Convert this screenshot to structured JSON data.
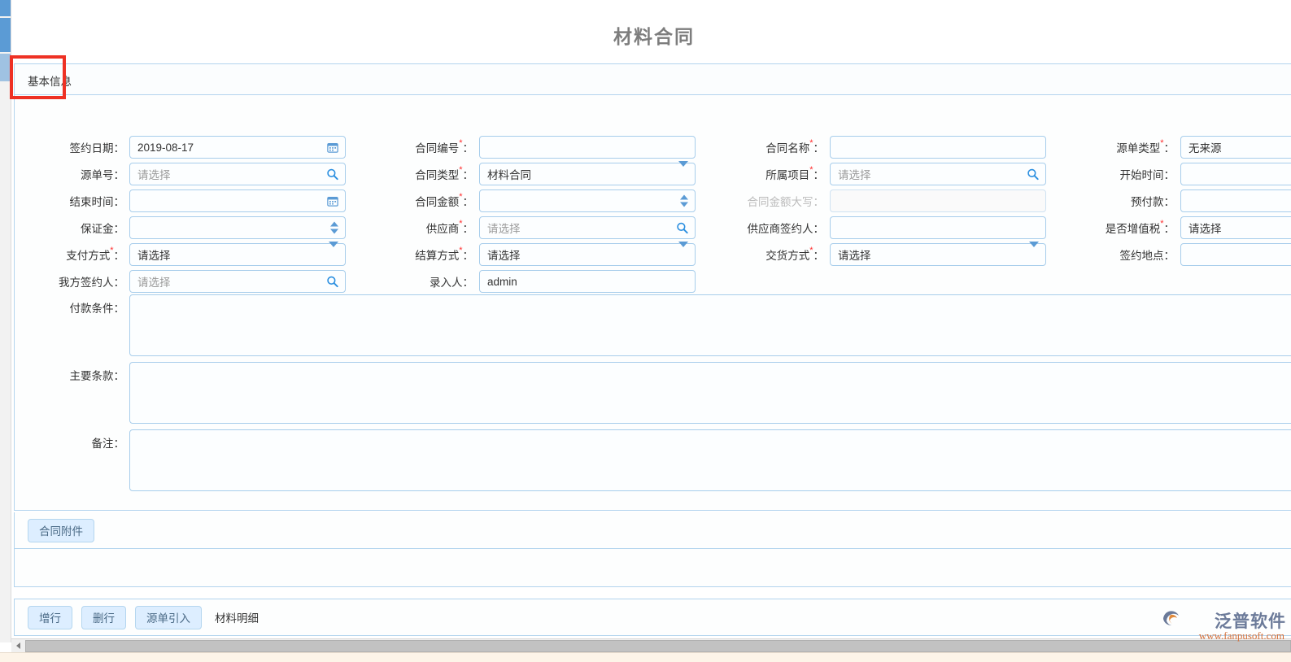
{
  "header": {
    "title": "材料合同"
  },
  "tabs": {
    "basic_info": "基本信息"
  },
  "form": {
    "columns": [
      {
        "fields": [
          {
            "label": "签约日期",
            "required": false,
            "value": "2019-08-17",
            "placeholder": "",
            "icon": "calendar-icon",
            "type": "date"
          },
          {
            "label": "源单号",
            "required": false,
            "value": "",
            "placeholder": "请选择",
            "icon": "search-icon",
            "type": "lookup"
          },
          {
            "label": "结束时间",
            "required": false,
            "value": "",
            "placeholder": "",
            "icon": "calendar-icon",
            "type": "date"
          },
          {
            "label": "保证金",
            "required": false,
            "value": "",
            "placeholder": "",
            "icon": "spinner-icon",
            "type": "number"
          },
          {
            "label": "支付方式",
            "required": true,
            "value": "请选择",
            "placeholder": "请选择",
            "icon": "chevron-down-icon",
            "type": "select"
          },
          {
            "label": "我方签约人",
            "required": false,
            "value": "",
            "placeholder": "请选择",
            "icon": "search-icon",
            "type": "lookup"
          }
        ]
      },
      {
        "fields": [
          {
            "label": "合同编号",
            "required": true,
            "value": "",
            "placeholder": "",
            "icon": "",
            "type": "text"
          },
          {
            "label": "合同类型",
            "required": true,
            "value": "材料合同",
            "placeholder": "",
            "icon": "chevron-down-icon",
            "type": "select"
          },
          {
            "label": "合同金额",
            "required": true,
            "value": "",
            "placeholder": "",
            "icon": "spinner-icon",
            "type": "number"
          },
          {
            "label": "供应商",
            "required": true,
            "value": "",
            "placeholder": "请选择",
            "icon": "search-icon",
            "type": "lookup"
          },
          {
            "label": "结算方式",
            "required": true,
            "value": "请选择",
            "placeholder": "请选择",
            "icon": "chevron-down-icon",
            "type": "select"
          },
          {
            "label": "录入人",
            "required": false,
            "value": "admin",
            "placeholder": "",
            "icon": "",
            "type": "text"
          }
        ]
      },
      {
        "fields": [
          {
            "label": "合同名称",
            "required": true,
            "value": "",
            "placeholder": "",
            "icon": "",
            "type": "text"
          },
          {
            "label": "所属项目",
            "required": true,
            "value": "",
            "placeholder": "请选择",
            "icon": "search-icon",
            "type": "lookup"
          },
          {
            "label": "合同金额大写",
            "required": false,
            "disabled": true,
            "value": "",
            "placeholder": "",
            "icon": "",
            "type": "text"
          },
          {
            "label": "供应商签约人",
            "required": false,
            "value": "",
            "placeholder": "",
            "icon": "",
            "type": "text"
          },
          {
            "label": "交货方式",
            "required": true,
            "value": "请选择",
            "placeholder": "请选择",
            "icon": "chevron-down-icon",
            "type": "select"
          }
        ]
      },
      {
        "fields": [
          {
            "label": "源单类型",
            "required": true,
            "value": "无来源",
            "placeholder": "",
            "icon": "",
            "type": "select"
          },
          {
            "label": "开始时间",
            "required": false,
            "value": "",
            "placeholder": "",
            "icon": "",
            "type": "date"
          },
          {
            "label": "预付款",
            "required": false,
            "value": "",
            "placeholder": "",
            "icon": "",
            "type": "number"
          },
          {
            "label": "是否增值税",
            "required": true,
            "value": "请选择",
            "placeholder": "请选择",
            "icon": "",
            "type": "select"
          },
          {
            "label": "签约地点",
            "required": false,
            "value": "",
            "placeholder": "",
            "icon": "",
            "type": "text"
          }
        ]
      }
    ],
    "textareas": [
      {
        "label": "付款条件",
        "value": "",
        "placeholder": ""
      },
      {
        "label": "主要条款",
        "value": "",
        "placeholder": ""
      },
      {
        "label": "备注",
        "value": "",
        "placeholder": ""
      }
    ]
  },
  "attachments": {
    "button_label": "合同附件"
  },
  "bottom_toolbar": {
    "buttons": [
      {
        "label": "增行",
        "name": "add-row-button"
      },
      {
        "label": "删行",
        "name": "delete-row-button"
      },
      {
        "label": "源单引入",
        "name": "import-source-button"
      }
    ],
    "section_label": "材料明细"
  },
  "watermark": {
    "brand": "泛普软件",
    "url": "www.fanpusoft.com"
  },
  "colors": {
    "accent_blue": "#5b9bd5",
    "border_blue": "#a7cdeb",
    "panel_border": "#b3d4ee",
    "button_bg": "#ddeeff",
    "required_red": "#ff2d2d",
    "annotation_red": "#ee3124",
    "title_gray": "#7d7d7d"
  }
}
